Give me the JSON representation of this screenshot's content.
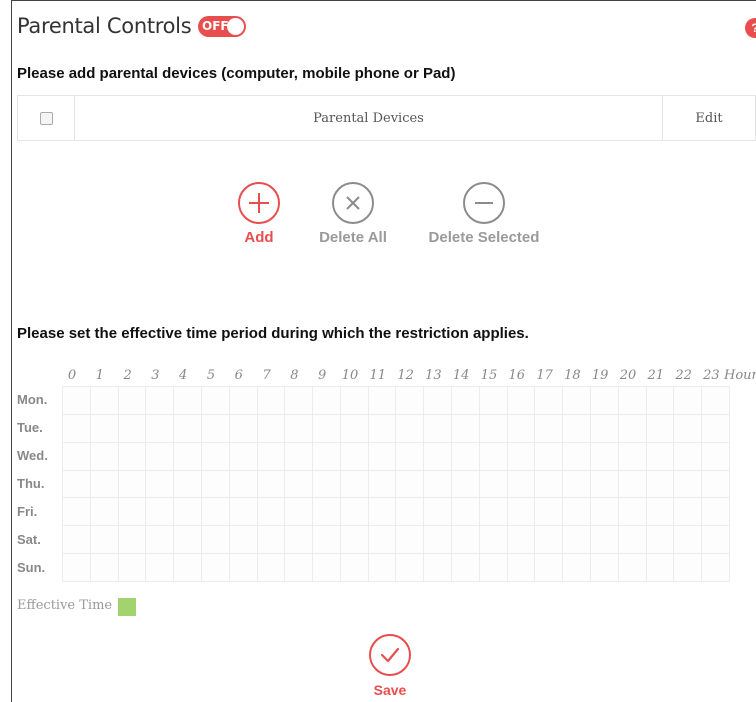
{
  "header": {
    "title": "Parental Controls",
    "toggle_label": "OFF",
    "help_label": "?"
  },
  "devices": {
    "heading": "Please add parental devices (computer, mobile phone or Pad)",
    "columns": {
      "name": "Parental Devices",
      "edit": "Edit"
    }
  },
  "actions": {
    "add": "Add",
    "delete_all": "Delete All",
    "delete_selected": "Delete Selected"
  },
  "schedule": {
    "heading": "Please set the effective time period during which the restriction applies.",
    "hours": [
      "0",
      "1",
      "2",
      "3",
      "4",
      "5",
      "6",
      "7",
      "8",
      "9",
      "10",
      "11",
      "12",
      "13",
      "14",
      "15",
      "16",
      "17",
      "18",
      "19",
      "20",
      "21",
      "22",
      "23"
    ],
    "hour_unit": "Hour",
    "days": [
      "Mon.",
      "Tue.",
      "Wed.",
      "Thu.",
      "Fri.",
      "Sat.",
      "Sun."
    ],
    "legend": "Effective Time",
    "legend_color": "#a2d36f"
  },
  "footer": {
    "save": "Save"
  },
  "colors": {
    "accent": "#e94e4e",
    "muted_icon": "#8c8c8c"
  }
}
